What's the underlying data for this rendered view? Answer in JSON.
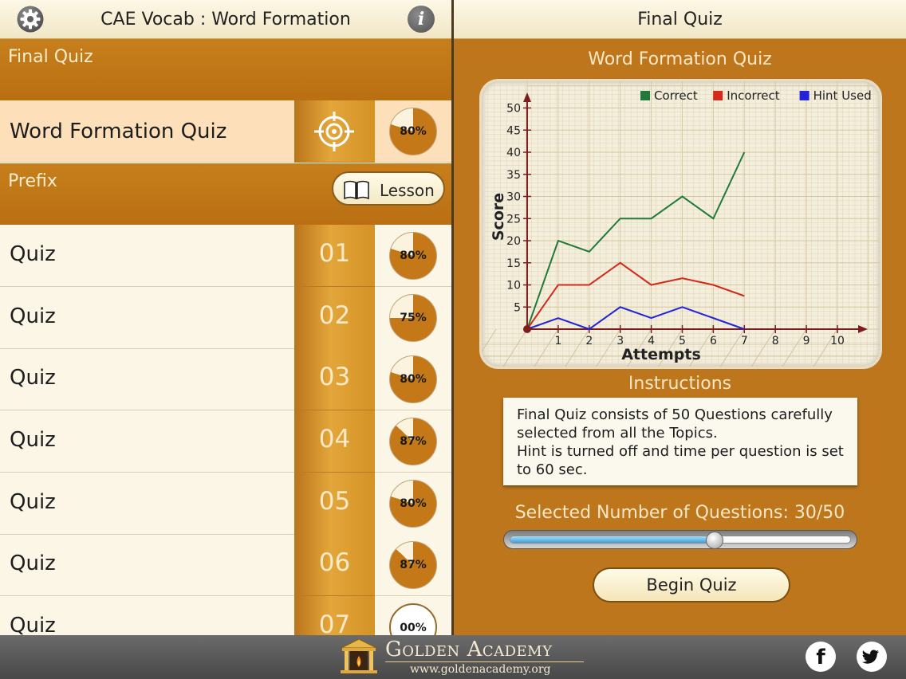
{
  "left": {
    "title": "CAE Vocab : Word Formation",
    "section_final": "Final Quiz",
    "word_formation": {
      "label": "Word Formation Quiz",
      "percent_label": "80%",
      "percent": 80
    },
    "section_prefix": "Prefix",
    "lesson_button": "Lesson",
    "quizzes": [
      {
        "label": "Quiz",
        "number": "01",
        "percent_label": "80%",
        "percent": 80
      },
      {
        "label": "Quiz",
        "number": "02",
        "percent_label": "75%",
        "percent": 75
      },
      {
        "label": "Quiz",
        "number": "03",
        "percent_label": "80%",
        "percent": 80
      },
      {
        "label": "Quiz",
        "number": "04",
        "percent_label": "87%",
        "percent": 87
      },
      {
        "label": "Quiz",
        "number": "05",
        "percent_label": "80%",
        "percent": 80
      },
      {
        "label": "Quiz",
        "number": "06",
        "percent_label": "87%",
        "percent": 87
      },
      {
        "label": "Quiz",
        "number": "07",
        "percent_label": "00%",
        "percent": 0
      }
    ]
  },
  "right": {
    "title": "Final Quiz",
    "chart_title": "Word Formation Quiz",
    "instructions_heading": "Instructions",
    "instructions": "Final Quiz consists of 50 Questions carefully selected from all the Topics.\nHint is turned off and time per question is set to 60 sec.",
    "selected_text": "Selected Number of Questions: 30/50",
    "selected_questions": 30,
    "max_questions": 50,
    "begin_button": "Begin Quiz"
  },
  "chart_data": {
    "type": "line",
    "title": "",
    "xlabel": "Attempts",
    "ylabel": "Score",
    "xlim": [
      0,
      10
    ],
    "ylim": [
      0,
      50
    ],
    "x_ticks": [
      "1",
      "2",
      "3",
      "4",
      "5",
      "6",
      "7",
      "8",
      "9",
      "10"
    ],
    "y_ticks": [
      "5",
      "10",
      "15",
      "20",
      "25",
      "30",
      "35",
      "40",
      "45",
      "50"
    ],
    "grid": true,
    "legend_position": "top-right",
    "series": [
      {
        "name": "Correct",
        "color": "#1f7a3a",
        "x": [
          0,
          1,
          2,
          3,
          4,
          5,
          6,
          7
        ],
        "values": [
          0,
          20,
          17.5,
          25,
          25,
          30,
          25,
          40
        ]
      },
      {
        "name": "Incorrect",
        "color": "#d42a1c",
        "x": [
          0,
          1,
          2,
          3,
          4,
          5,
          6,
          7
        ],
        "values": [
          0,
          10,
          10,
          15,
          10,
          11.5,
          10,
          7.5
        ]
      },
      {
        "name": "Hint Used",
        "color": "#2323d8",
        "x": [
          0,
          1,
          2,
          3,
          4,
          5,
          6,
          7
        ],
        "values": [
          0,
          2.5,
          0,
          5,
          2.5,
          5,
          2.5,
          0
        ]
      }
    ]
  },
  "footer": {
    "brand": "Golden Academy",
    "url": "www.goldenacademy.org"
  },
  "colors": {
    "accent_orange": "#bd761c",
    "highlight_row": "#fde0b9",
    "pie_fill": "#c47818",
    "footer": "#555555"
  },
  "icons": {
    "settings": "gear-icon",
    "info": "info-icon",
    "target": "target-icon",
    "lesson": "book-icon",
    "logo": "temple-icon",
    "facebook": "facebook-icon",
    "twitter": "twitter-icon"
  }
}
